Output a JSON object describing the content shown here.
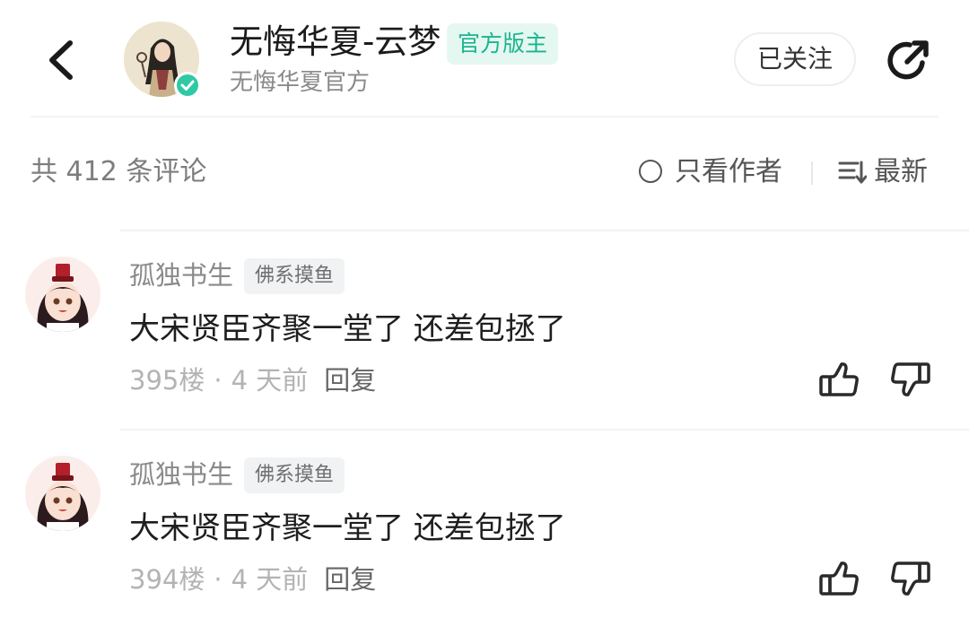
{
  "header": {
    "author_name": "无悔华夏-云梦",
    "badge": "官方版主",
    "subtitle": "无悔华夏官方",
    "follow_label": "已关注",
    "back_icon": "chevron-left-icon",
    "share_icon": "share-icon",
    "verified_icon": "verified-check-icon"
  },
  "filter_bar": {
    "count_text": "共 412 条评论",
    "author_only_label": "只看作者",
    "sort_label": "最新"
  },
  "comments": [
    {
      "user": "孤独书生",
      "tag": "佛系摸鱼",
      "text": "大宋贤臣齐聚一堂了 还差包拯了",
      "floor": "395楼",
      "separator": "·",
      "time": "4 天前",
      "reply_label": "回复"
    },
    {
      "user": "孤独书生",
      "tag": "佛系摸鱼",
      "text": "大宋贤臣齐聚一堂了 还差包拯了",
      "floor": "394楼",
      "separator": "·",
      "time": "4 天前",
      "reply_label": "回复"
    }
  ],
  "colors": {
    "accent": "#1bb58e",
    "badge_bg": "#e5f7f1",
    "verified": "#2fc9a4",
    "text_primary": "#1e1e1e",
    "text_secondary": "#8a8a8a"
  }
}
